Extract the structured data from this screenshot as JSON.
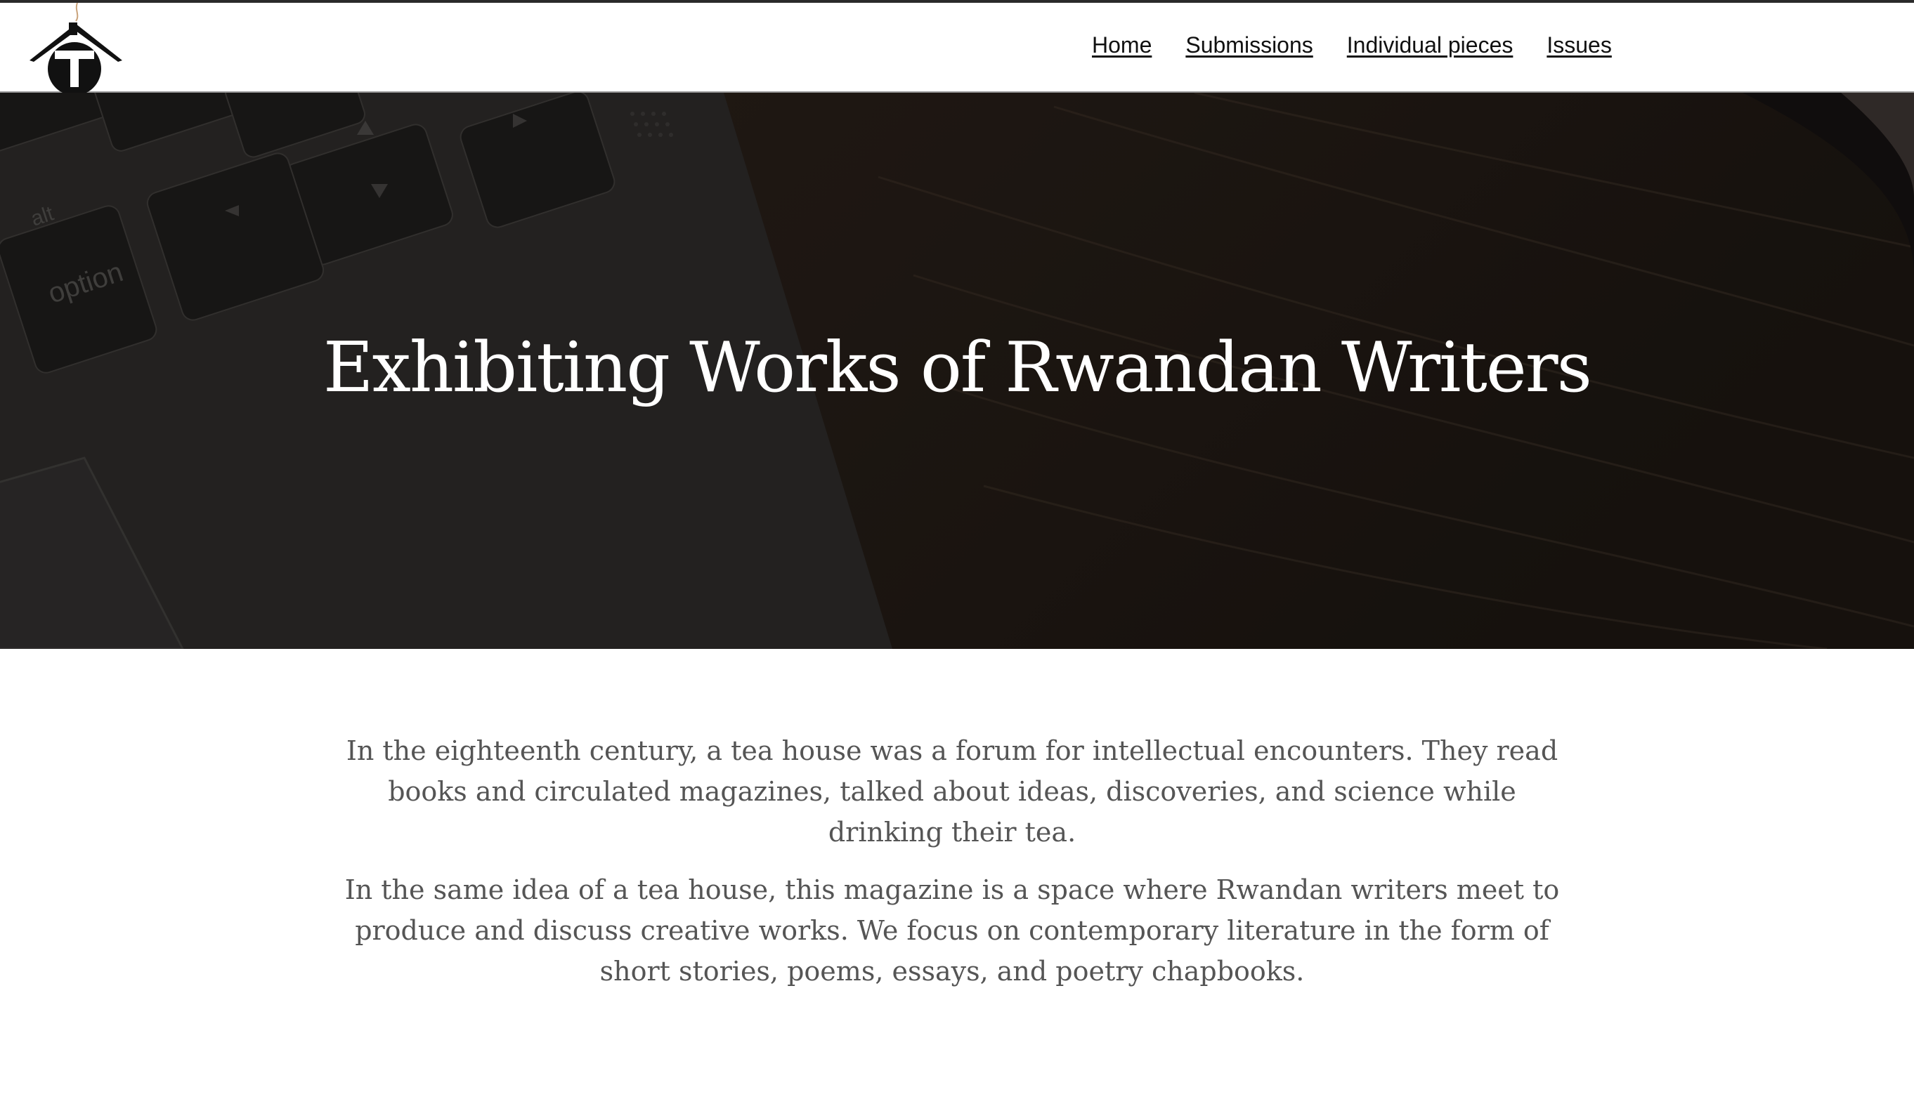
{
  "site": {
    "logo_icon": "tea-house-t-logo-icon"
  },
  "nav": {
    "items": [
      {
        "label": "Home"
      },
      {
        "label": "Submissions"
      },
      {
        "label": "Individual pieces"
      },
      {
        "label": "Issues"
      }
    ]
  },
  "hero": {
    "title": "Exhibiting Works of Rwandan Writers",
    "keyboard_keys": [
      "alt",
      "option"
    ]
  },
  "intro": {
    "paragraphs": [
      "In the eighteenth century, a tea house was a forum for intellectual encounters. They read books and circulated magazines, talked about ideas, discoveries, and science while drinking their tea.",
      "In the same idea of a tea house, this magazine is a space where Rwandan writers meet to produce and discuss creative works. We focus on contemporary literature in the form of short stories, poems, essays, and poetry chapbooks."
    ]
  },
  "colors": {
    "nav_text": "#111111",
    "hero_overlay": "#1a1512",
    "hero_title": "#ffffff",
    "body_text": "#555555"
  }
}
